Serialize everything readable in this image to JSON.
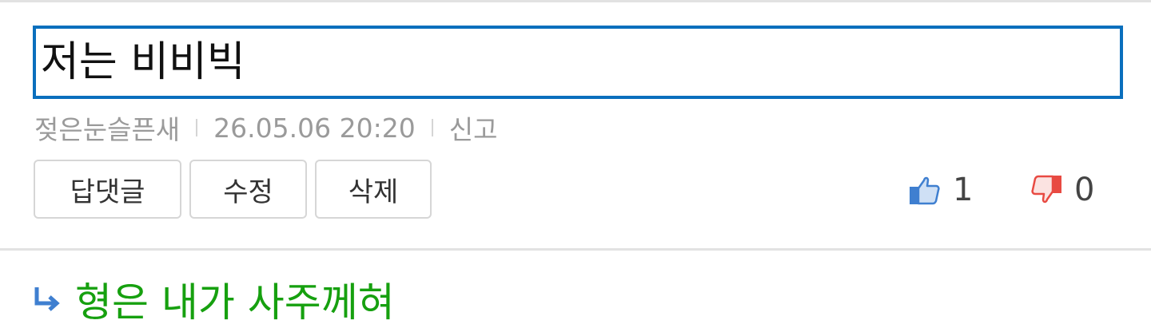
{
  "comment": {
    "input_text": "저는 비비빅",
    "author": "젖은눈슬픈새",
    "timestamp": "26.05.06  20:20",
    "report_label": "신고"
  },
  "actions": {
    "reply_label": "답댓글",
    "edit_label": "수정",
    "delete_label": "삭제"
  },
  "votes": {
    "up_count": "1",
    "down_count": "0"
  },
  "reply": {
    "text": "형은 내가 사주께혀"
  },
  "colors": {
    "input_border": "#0a6fbd",
    "meta_text": "#9a9a9a",
    "reply_text": "#16a00f",
    "thumb_up": "#3f7fd0",
    "thumb_down": "#e84a42"
  }
}
